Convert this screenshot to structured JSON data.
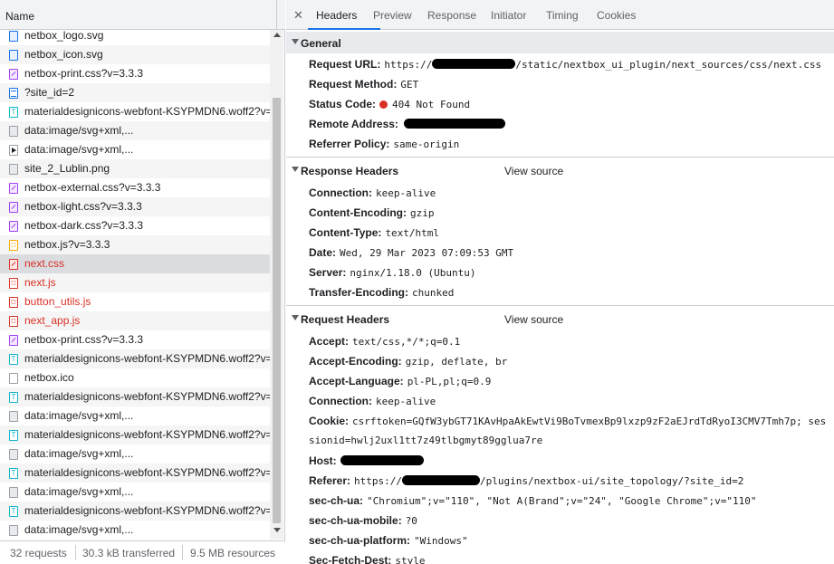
{
  "left": {
    "column_name": "Name",
    "requests": [
      {
        "name": "netbox_logo.svg",
        "icon": "svgimg",
        "error": false,
        "selected": false
      },
      {
        "name": "netbox_icon.svg",
        "icon": "svgimg",
        "error": false,
        "selected": false
      },
      {
        "name": "netbox-print.css?v=3.3.3",
        "icon": "css",
        "error": false,
        "selected": false
      },
      {
        "name": "?site_id=2",
        "icon": "doc",
        "error": false,
        "selected": false
      },
      {
        "name": "materialdesignicons-webfont-KSYPMDN6.woff2?v=",
        "icon": "font",
        "error": false,
        "selected": false
      },
      {
        "name": "data:image/svg+xml,...",
        "icon": "img",
        "error": false,
        "selected": false
      },
      {
        "name": "data:image/svg+xml,...",
        "icon": "blackimg",
        "error": false,
        "selected": false
      },
      {
        "name": "site_2_Lublin.png",
        "icon": "img",
        "error": false,
        "selected": false
      },
      {
        "name": "netbox-external.css?v=3.3.3",
        "icon": "css",
        "error": false,
        "selected": false
      },
      {
        "name": "netbox-light.css?v=3.3.3",
        "icon": "css",
        "error": false,
        "selected": false
      },
      {
        "name": "netbox-dark.css?v=3.3.3",
        "icon": "css",
        "error": false,
        "selected": false
      },
      {
        "name": "netbox.js?v=3.3.3",
        "icon": "js",
        "error": false,
        "selected": false
      },
      {
        "name": "next.css",
        "icon": "errcss",
        "error": true,
        "selected": true
      },
      {
        "name": "next.js",
        "icon": "errjs",
        "error": true,
        "selected": false
      },
      {
        "name": "button_utils.js",
        "icon": "errjs",
        "error": true,
        "selected": false
      },
      {
        "name": "next_app.js",
        "icon": "errjs",
        "error": true,
        "selected": false
      },
      {
        "name": "netbox-print.css?v=3.3.3",
        "icon": "css",
        "error": false,
        "selected": false
      },
      {
        "name": "materialdesignicons-webfont-KSYPMDN6.woff2?v=",
        "icon": "font",
        "error": false,
        "selected": false
      },
      {
        "name": "netbox.ico",
        "icon": "ico",
        "error": false,
        "selected": false
      },
      {
        "name": "materialdesignicons-webfont-KSYPMDN6.woff2?v=",
        "icon": "font",
        "error": false,
        "selected": false
      },
      {
        "name": "data:image/svg+xml,...",
        "icon": "img",
        "error": false,
        "selected": false
      },
      {
        "name": "materialdesignicons-webfont-KSYPMDN6.woff2?v=",
        "icon": "font",
        "error": false,
        "selected": false
      },
      {
        "name": "data:image/svg+xml,...",
        "icon": "img",
        "error": false,
        "selected": false
      },
      {
        "name": "materialdesignicons-webfont-KSYPMDN6.woff2?v=",
        "icon": "font",
        "error": false,
        "selected": false
      },
      {
        "name": "data:image/svg+xml,...",
        "icon": "img",
        "error": false,
        "selected": false
      },
      {
        "name": "materialdesignicons-webfont-KSYPMDN6.woff2?v=",
        "icon": "font",
        "error": false,
        "selected": false
      },
      {
        "name": "data:image/svg+xml,...",
        "icon": "img",
        "error": false,
        "selected": false
      }
    ],
    "status": {
      "requests": "32 requests",
      "transferred": "30.3 kB transferred",
      "resources": "9.5 MB resources"
    }
  },
  "tabs": [
    "Headers",
    "Preview",
    "Response",
    "Initiator",
    "Timing",
    "Cookies"
  ],
  "active_tab": "Headers",
  "general": {
    "title": "General",
    "request_url_label": "Request URL:",
    "request_url_prefix": "https://",
    "request_url_suffix": "/static/nextbox_ui_plugin/next_sources/css/next.css",
    "request_method_label": "Request Method:",
    "request_method": "GET",
    "status_code_label": "Status Code:",
    "status_code": "404 Not Found",
    "remote_address_label": "Remote Address:",
    "referrer_policy_label": "Referrer Policy:",
    "referrer_policy": "same-origin"
  },
  "response_headers": {
    "title": "Response Headers",
    "view_source": "View source",
    "items": [
      {
        "key": "Connection:",
        "value": "keep-alive"
      },
      {
        "key": "Content-Encoding:",
        "value": "gzip"
      },
      {
        "key": "Content-Type:",
        "value": "text/html"
      },
      {
        "key": "Date:",
        "value": "Wed, 29 Mar 2023 07:09:53 GMT"
      },
      {
        "key": "Server:",
        "value": "nginx/1.18.0 (Ubuntu)"
      },
      {
        "key": "Transfer-Encoding:",
        "value": "chunked"
      }
    ]
  },
  "request_headers": {
    "title": "Request Headers",
    "view_source": "View source",
    "accept_label": "Accept:",
    "accept": "text/css,*/*;q=0.1",
    "accept_encoding_label": "Accept-Encoding:",
    "accept_encoding": "gzip, deflate, br",
    "accept_language_label": "Accept-Language:",
    "accept_language": "pl-PL,pl;q=0.9",
    "connection_label": "Connection:",
    "connection": "keep-alive",
    "cookie_label": "Cookie:",
    "cookie_line1": "csrftoken=GQfW3ybGT71KAvHpaAkEwtVi9BoTvmexBp9lxzp9zF2aEJrdTdRyoI3CMV7Tmh7p; ses",
    "cookie_line2": "sionid=hwlj2uxl1tt7z49tlbgmyt89gglua7re",
    "host_label": "Host:",
    "referer_label": "Referer:",
    "referer_prefix": "https://",
    "referer_suffix": "/plugins/nextbox-ui/site_topology/?site_id=2",
    "sec_ch_ua_label": "sec-ch-ua:",
    "sec_ch_ua": "\"Chromium\";v=\"110\", \"Not A(Brand\";v=\"24\", \"Google Chrome\";v=\"110\"",
    "sec_ch_ua_mobile_label": "sec-ch-ua-mobile:",
    "sec_ch_ua_mobile": "?0",
    "sec_ch_ua_platform_label": "sec-ch-ua-platform:",
    "sec_ch_ua_platform": "\"Windows\"",
    "sec_fetch_dest_label": "Sec-Fetch-Dest:",
    "sec_fetch_dest": "style"
  }
}
